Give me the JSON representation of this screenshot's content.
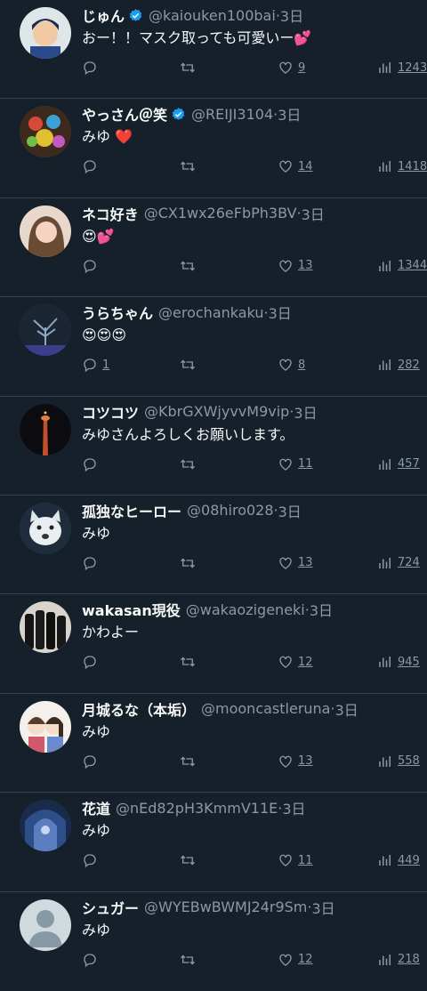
{
  "colors": {
    "background": "#15202b",
    "text": "#f7f9f9",
    "muted": "#8b98a5",
    "verified": "#1d9bf0",
    "heart": "#f91880"
  },
  "tweets": [
    {
      "name": "じゅん",
      "verified": true,
      "handle": "@kaiouken100bai",
      "sep": "·",
      "time": "3日",
      "text": "おー！！マスク取っても可愛いー💕",
      "replies": "",
      "likes": "9",
      "views": "1243"
    },
    {
      "name": "やっさん＠笑",
      "verified": true,
      "handle": "@REIJI3104",
      "sep": "·",
      "time": "3日",
      "text": "みゆ ❤️",
      "replies": "",
      "likes": "14",
      "views": "1418"
    },
    {
      "name": "ネコ好き",
      "verified": false,
      "handle": "@CX1wx26eFbPh3BV",
      "sep": "·",
      "time": "3日",
      "text": "😍💕",
      "replies": "",
      "likes": "13",
      "views": "1344"
    },
    {
      "name": "うらちゃん",
      "verified": false,
      "handle": "@erochankaku",
      "sep": "·",
      "time": "3日",
      "text": "😍😍😍",
      "replies": "1",
      "likes": "8",
      "views": "282"
    },
    {
      "name": "コツコツ",
      "verified": false,
      "handle": "@KbrGXWjyvvM9vip",
      "sep": "·",
      "time": "3日",
      "text": "みゆさんよろしくお願いします。",
      "replies": "",
      "likes": "11",
      "views": "457"
    },
    {
      "name": "孤独なヒーロー",
      "verified": false,
      "handle": "@08hiro028",
      "sep": "·",
      "time": "3日",
      "text": "みゆ",
      "replies": "",
      "likes": "13",
      "views": "724"
    },
    {
      "name": "wakasan現役",
      "verified": false,
      "handle": "@wakaozigeneki",
      "sep": "·",
      "time": "3日",
      "text": "かわよー",
      "replies": "",
      "likes": "12",
      "views": "945"
    },
    {
      "name": "月城るな（本垢）",
      "verified": false,
      "handle": "@mooncastleruna",
      "sep": "·",
      "time": "3日",
      "text": "みゆ",
      "replies": "",
      "likes": "13",
      "views": "558"
    },
    {
      "name": "花道",
      "verified": false,
      "handle": "@nEd82pH3KmmV11E",
      "sep": "·",
      "time": "3日",
      "text": "みゆ",
      "replies": "",
      "likes": "11",
      "views": "449"
    },
    {
      "name": "シュガー",
      "verified": false,
      "handle": "@WYEBwBWMJ24r9Sm",
      "sep": "·",
      "time": "3日",
      "text": "みゆ",
      "replies": "",
      "likes": "12",
      "views": "218"
    }
  ]
}
